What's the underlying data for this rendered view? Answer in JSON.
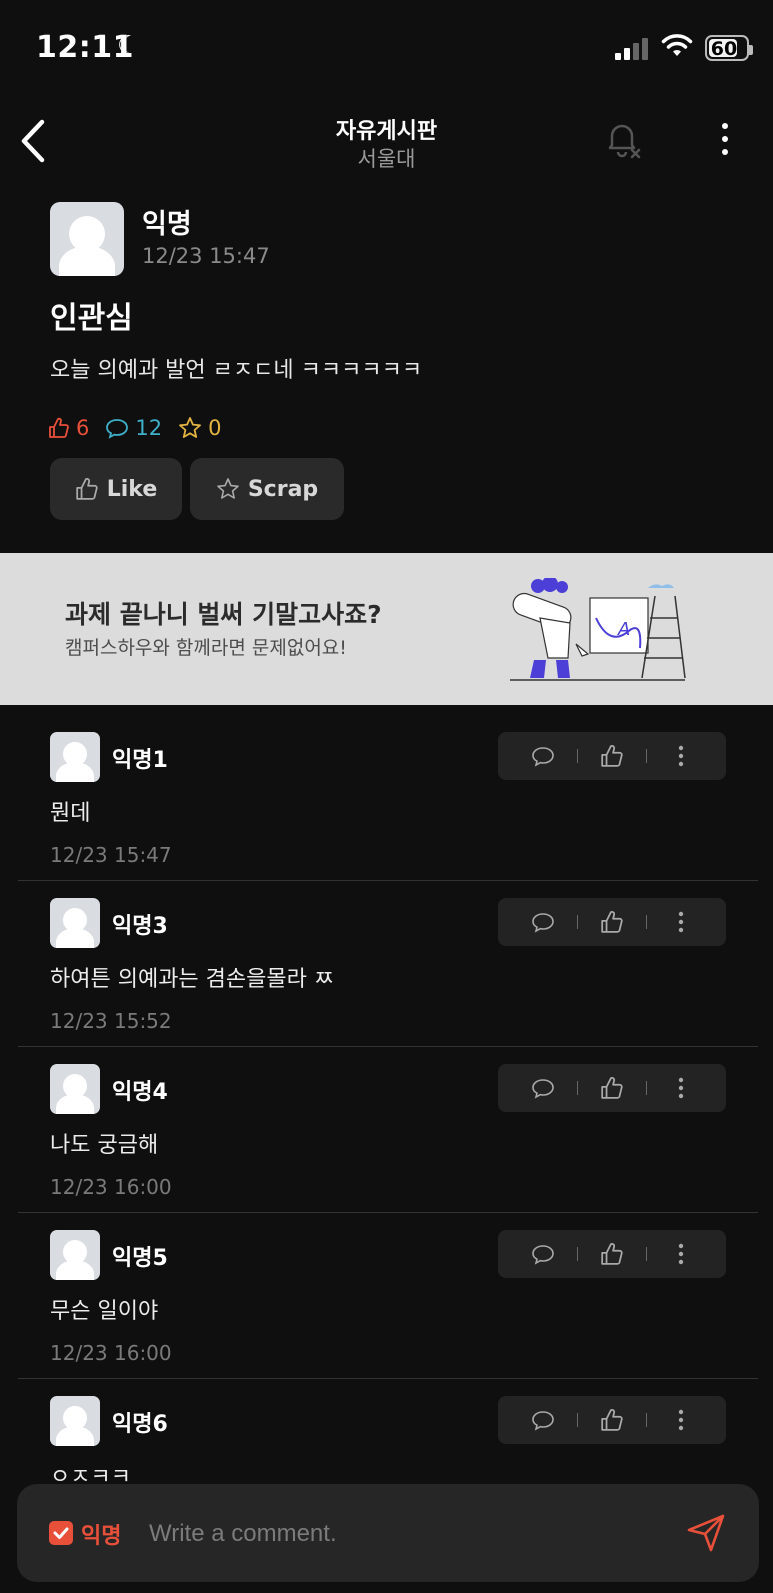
{
  "status_bar": {
    "time": "12:11",
    "battery": "60"
  },
  "nav": {
    "title": "자유게시판",
    "subtitle": "서울대"
  },
  "post": {
    "author": "익명",
    "time": "12/23 15:47",
    "title": "인관심",
    "body": "오늘 의예과 발언 ㄹㅈㄷ네 ㅋㅋㅋㅋㅋㅋ",
    "likes": "6",
    "comments": "12",
    "scraps": "0",
    "like_label": "Like",
    "scrap_label": "Scrap"
  },
  "ad": {
    "title": "과제 끝나니 벌써 기말고사죠?",
    "subtitle": "캠퍼스하우와 함께라면 문제없어요!"
  },
  "comments": [
    {
      "author": "익명1",
      "text": "뭔데",
      "time": "12/23 15:47"
    },
    {
      "author": "익명3",
      "text": "하여튼 의예과는 겸손을몰라 ㅉ",
      "time": "12/23 15:52"
    },
    {
      "author": "익명4",
      "text": "나도 궁금해",
      "time": "12/23 16:00"
    },
    {
      "author": "익명5",
      "text": "무슨 일이야",
      "time": "12/23 16:00"
    },
    {
      "author": "익명6",
      "text": "ㅇㅈㅋㅋ",
      "time": ""
    }
  ],
  "composer": {
    "anon_label": "익명",
    "placeholder": "Write a comment."
  },
  "colors": {
    "accent": "#e8503a",
    "comment_stat": "#3fb0c9",
    "scrap_stat": "#e3b341",
    "background": "#0f0f0f"
  }
}
